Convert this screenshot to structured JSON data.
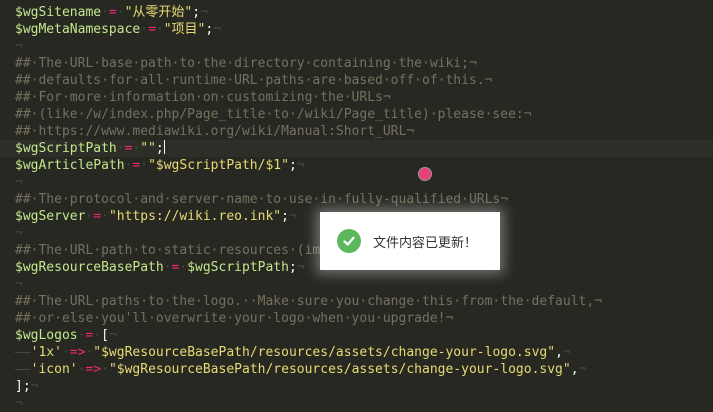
{
  "editor": {
    "lines": [
      [
        {
          "t": "$wgSitename",
          "c": "var"
        },
        {
          "t": "·",
          "c": "ws"
        },
        {
          "t": "=",
          "c": "op"
        },
        {
          "t": "·",
          "c": "ws"
        },
        {
          "t": "\"从零开始\"",
          "c": "str"
        },
        {
          "t": ";",
          "c": "punct"
        },
        {
          "t": "¬",
          "c": "ws"
        }
      ],
      [
        {
          "t": "$wgMetaNamespace",
          "c": "var"
        },
        {
          "t": "·",
          "c": "ws"
        },
        {
          "t": "=",
          "c": "op"
        },
        {
          "t": "·",
          "c": "ws"
        },
        {
          "t": "\"项目\"",
          "c": "str"
        },
        {
          "t": ";",
          "c": "punct"
        },
        {
          "t": "¬",
          "c": "ws"
        }
      ],
      [
        {
          "t": "¬",
          "c": "ws"
        }
      ],
      [
        {
          "t": "##·The·URL·base·path·to·the·directory·containing·the·wiki;¬",
          "c": "cmt"
        }
      ],
      [
        {
          "t": "##·defaults·for·all·runtime·URL·paths·are·based·off·of·this.¬",
          "c": "cmt"
        }
      ],
      [
        {
          "t": "##·For·more·information·on·customizing·the·URLs¬",
          "c": "cmt"
        }
      ],
      [
        {
          "t": "##·(like·/w/index.php/Page_title·to·/wiki/Page_title)·please·see:¬",
          "c": "cmt"
        }
      ],
      [
        {
          "t": "##·https://www.mediawiki.org/wiki/Manual:Short_URL¬",
          "c": "cmt"
        }
      ],
      [
        {
          "t": "$wgScriptPath",
          "c": "var"
        },
        {
          "t": "·",
          "c": "ws"
        },
        {
          "t": "=",
          "c": "op"
        },
        {
          "t": "·",
          "c": "ws"
        },
        {
          "t": "\"\"",
          "c": "str"
        },
        {
          "t": ";",
          "c": "punct"
        }
      ],
      [
        {
          "t": "$wgArticlePath",
          "c": "var"
        },
        {
          "t": "·",
          "c": "ws"
        },
        {
          "t": "=",
          "c": "op"
        },
        {
          "t": "·",
          "c": "ws"
        },
        {
          "t": "\"$wgScriptPath/$1\"",
          "c": "str"
        },
        {
          "t": ";",
          "c": "punct"
        },
        {
          "t": "¬",
          "c": "ws"
        }
      ],
      [
        {
          "t": "¬",
          "c": "ws"
        }
      ],
      [
        {
          "t": "##·The·protocol·and·server·name·to·use·in·fully-qualified·URLs¬",
          "c": "cmt"
        }
      ],
      [
        {
          "t": "$wgServer",
          "c": "var"
        },
        {
          "t": "·",
          "c": "ws"
        },
        {
          "t": "=",
          "c": "op"
        },
        {
          "t": "·",
          "c": "ws"
        },
        {
          "t": "\"https://wiki.reo.ink\"",
          "c": "str"
        },
        {
          "t": ";",
          "c": "punct"
        },
        {
          "t": "¬",
          "c": "ws"
        }
      ],
      [
        {
          "t": "¬",
          "c": "ws"
        }
      ],
      [
        {
          "t": "##·The·URL·path·to·static·resources·(ima",
          "c": "cmt"
        }
      ],
      [
        {
          "t": "$wgResourceBasePath",
          "c": "var"
        },
        {
          "t": "·",
          "c": "ws"
        },
        {
          "t": "=",
          "c": "op"
        },
        {
          "t": "·",
          "c": "ws"
        },
        {
          "t": "$wgScriptPath",
          "c": "var"
        },
        {
          "t": ";",
          "c": "punct"
        },
        {
          "t": "¬",
          "c": "ws"
        }
      ],
      [
        {
          "t": "¬",
          "c": "ws"
        }
      ],
      [
        {
          "t": "##·The·URL·paths·to·the·logo.··Make·sure·you·change·this·from·the·default,¬",
          "c": "cmt"
        }
      ],
      [
        {
          "t": "##·or·else·you'll·overwrite·your·logo·when·you·upgrade!¬",
          "c": "cmt"
        }
      ],
      [
        {
          "t": "$wgLogos",
          "c": "var"
        },
        {
          "t": "·",
          "c": "ws"
        },
        {
          "t": "=",
          "c": "op"
        },
        {
          "t": "·",
          "c": "ws"
        },
        {
          "t": "[",
          "c": "punct"
        },
        {
          "t": "¬",
          "c": "ws"
        }
      ],
      [
        {
          "t": "——",
          "c": "ws"
        },
        {
          "t": "'1x'",
          "c": "str"
        },
        {
          "t": "·",
          "c": "ws"
        },
        {
          "t": "=>",
          "c": "op"
        },
        {
          "t": "·",
          "c": "ws"
        },
        {
          "t": "\"$wgResourceBasePath/resources/assets/change-your-logo.svg\"",
          "c": "str"
        },
        {
          "t": ",",
          "c": "punct"
        },
        {
          "t": "¬",
          "c": "ws"
        }
      ],
      [
        {
          "t": "——",
          "c": "ws"
        },
        {
          "t": "'icon'",
          "c": "str"
        },
        {
          "t": "·",
          "c": "ws"
        },
        {
          "t": "=>",
          "c": "op"
        },
        {
          "t": "·",
          "c": "ws"
        },
        {
          "t": "\"$wgResourceBasePath/resources/assets/change-your-logo.svg\"",
          "c": "str"
        },
        {
          "t": ",",
          "c": "punct"
        },
        {
          "t": "¬",
          "c": "ws"
        }
      ],
      [
        {
          "t": "];",
          "c": "punct"
        },
        {
          "t": "¬",
          "c": "ws"
        }
      ],
      [
        {
          "t": "¬",
          "c": "ws"
        }
      ]
    ],
    "current_line": 8
  },
  "toast": {
    "message": "文件内容已更新！",
    "icon": "check-circle-icon",
    "icon_color": "#5cb85c"
  },
  "colors": {
    "background": "#272822",
    "variable": "#c3e88d",
    "operator": "#f92672",
    "string": "#e6db74",
    "comment": "#75715e"
  }
}
